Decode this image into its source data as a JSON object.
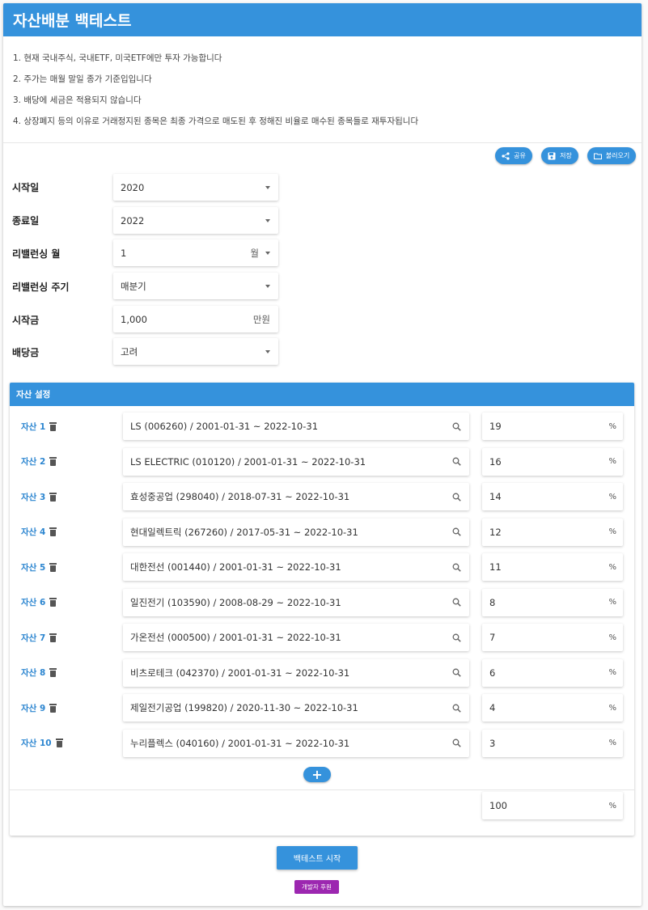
{
  "app": {
    "title": "자산배분 백테스트"
  },
  "notes": [
    "1. 현재 국내주식, 국내ETF, 미국ETF에만 투자 가능합니다",
    "2. 주가는 매월 말일 종가 기준입입니다",
    "3. 배당에 세금은 적용되지 않습니다",
    "4. 상장폐지 등의 이유로 거래정지된 종목은 최종 가격으로 매도된 후 정해진 비율로 매수된 종목들로 재투자됩니다"
  ],
  "toolbar": {
    "share": "공유",
    "save": "저장",
    "load": "불러오기"
  },
  "form": {
    "start_date": {
      "label": "시작일",
      "value": "2020"
    },
    "end_date": {
      "label": "종료일",
      "value": "2022"
    },
    "rebalance_month": {
      "label": "리밸런싱 월",
      "value": "1",
      "suffix": "월"
    },
    "rebalance_period": {
      "label": "리밸런싱 주기",
      "value": "매분기"
    },
    "initial_amount": {
      "label": "시작금",
      "value": "1,000",
      "suffix": "만원"
    },
    "dividend": {
      "label": "배당금",
      "value": "고려"
    }
  },
  "assets": {
    "header": "자산 설정",
    "percent_symbol": "%",
    "items": [
      {
        "label": "자산 1",
        "stock": "LS (006260) / 2001-01-31 ~ 2022-10-31",
        "weight": "19"
      },
      {
        "label": "자산 2",
        "stock": "LS ELECTRIC (010120) / 2001-01-31 ~ 2022-10-31",
        "weight": "16"
      },
      {
        "label": "자산 3",
        "stock": "효성중공업 (298040) / 2018-07-31 ~ 2022-10-31",
        "weight": "14"
      },
      {
        "label": "자산 4",
        "stock": "현대일렉트릭 (267260) / 2017-05-31 ~ 2022-10-31",
        "weight": "12"
      },
      {
        "label": "자산 5",
        "stock": "대한전선 (001440) / 2001-01-31 ~ 2022-10-31",
        "weight": "11"
      },
      {
        "label": "자산 6",
        "stock": "일진전기 (103590) / 2008-08-29 ~ 2022-10-31",
        "weight": "8"
      },
      {
        "label": "자산 7",
        "stock": "가온전선 (000500) / 2001-01-31 ~ 2022-10-31",
        "weight": "7"
      },
      {
        "label": "자산 8",
        "stock": "비츠로테크 (042370) / 2001-01-31 ~ 2022-10-31",
        "weight": "6"
      },
      {
        "label": "자산 9",
        "stock": "제일전기공업 (199820) / 2020-11-30 ~ 2022-10-31",
        "weight": "4"
      },
      {
        "label": "자산 10",
        "stock": "누리플렉스 (040160) / 2001-01-31 ~ 2022-10-31",
        "weight": "3"
      }
    ],
    "add_label": "+",
    "total": "100"
  },
  "actions": {
    "start": "백테스트 시작",
    "sponsor": "개발자 후원"
  },
  "colors": {
    "primary": "#3592dc",
    "sponsor": "#9c27b0"
  }
}
